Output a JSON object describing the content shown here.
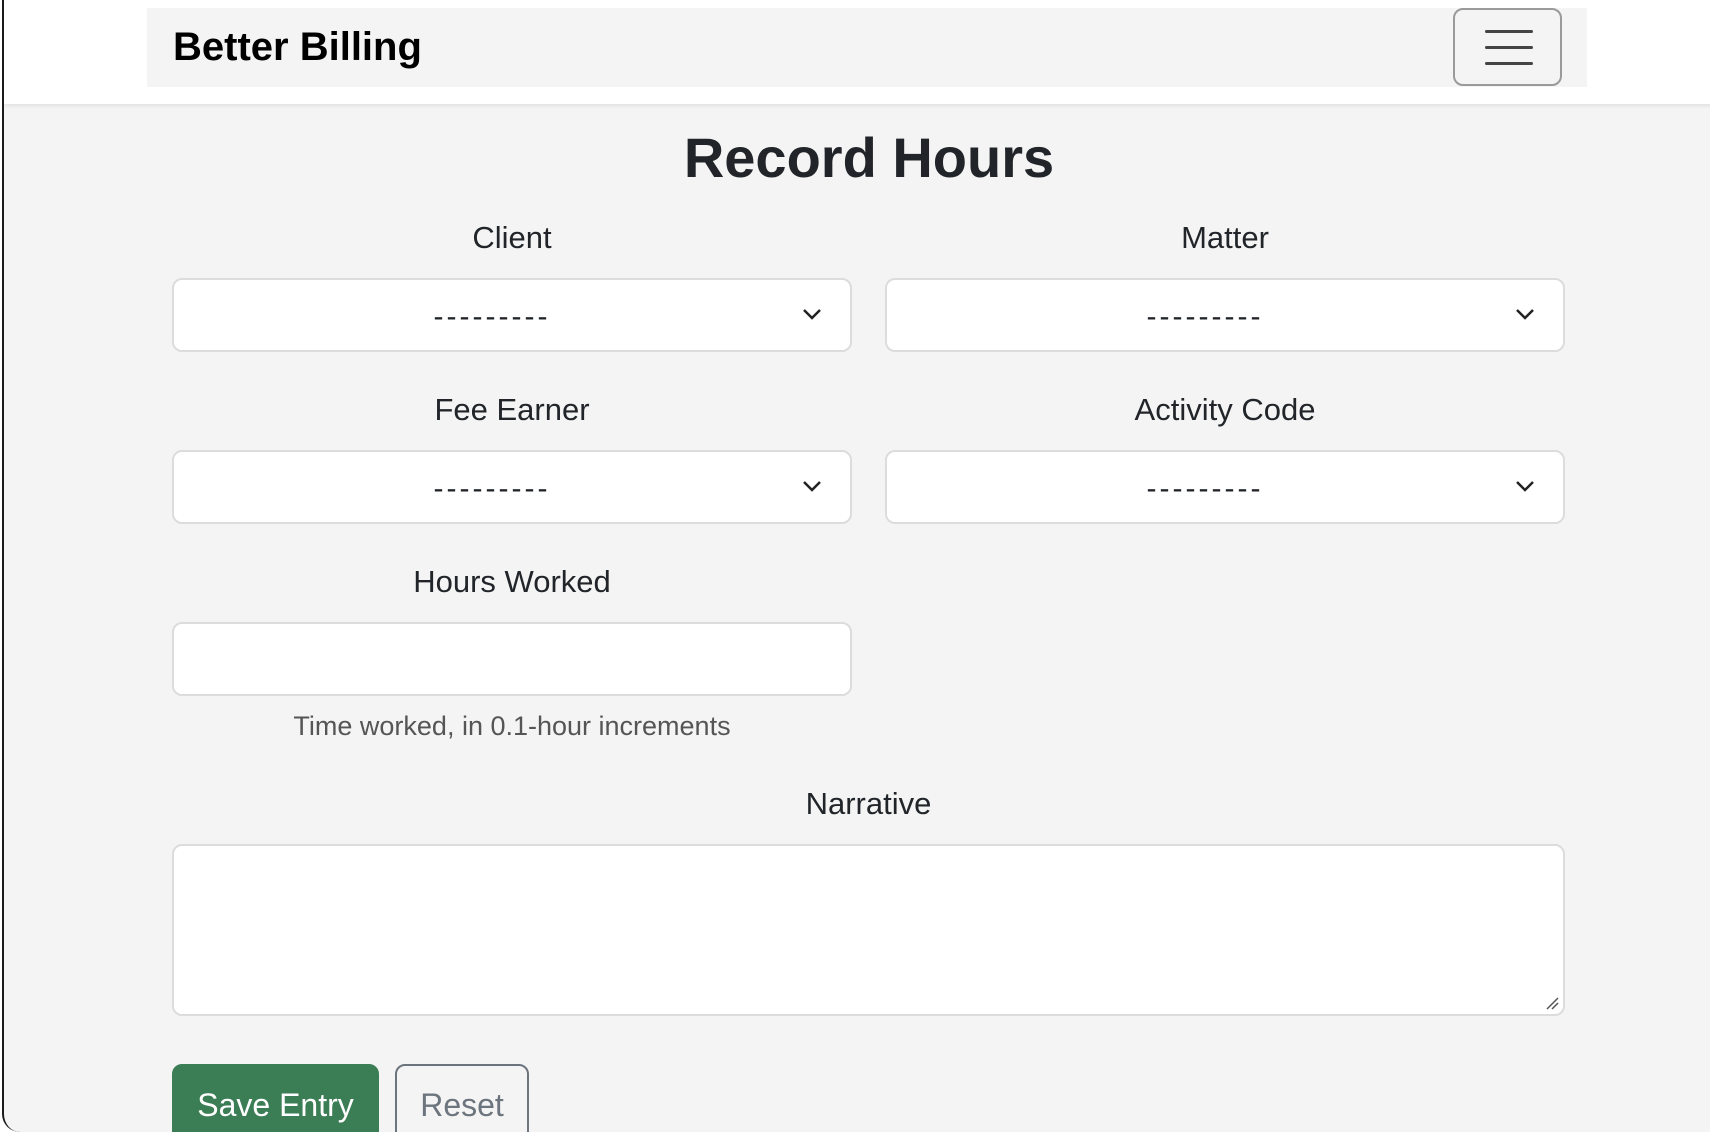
{
  "navbar": {
    "brand": "Better Billing",
    "toggle_icon": "hamburger-menu-icon"
  },
  "page": {
    "title": "Record Hours"
  },
  "form": {
    "client": {
      "label": "Client",
      "value": "---------"
    },
    "matter": {
      "label": "Matter",
      "value": "---------"
    },
    "fee_earner": {
      "label": "Fee Earner",
      "value": "---------"
    },
    "activity_code": {
      "label": "Activity Code",
      "value": "---------"
    },
    "hours_worked": {
      "label": "Hours Worked",
      "value": "",
      "help": "Time worked, in 0.1-hour increments"
    },
    "narrative": {
      "label": "Narrative",
      "value": ""
    }
  },
  "buttons": {
    "save": "Save Entry",
    "reset": "Reset"
  },
  "colors": {
    "primary": "#3b7d55",
    "background": "#f4f4f4"
  }
}
